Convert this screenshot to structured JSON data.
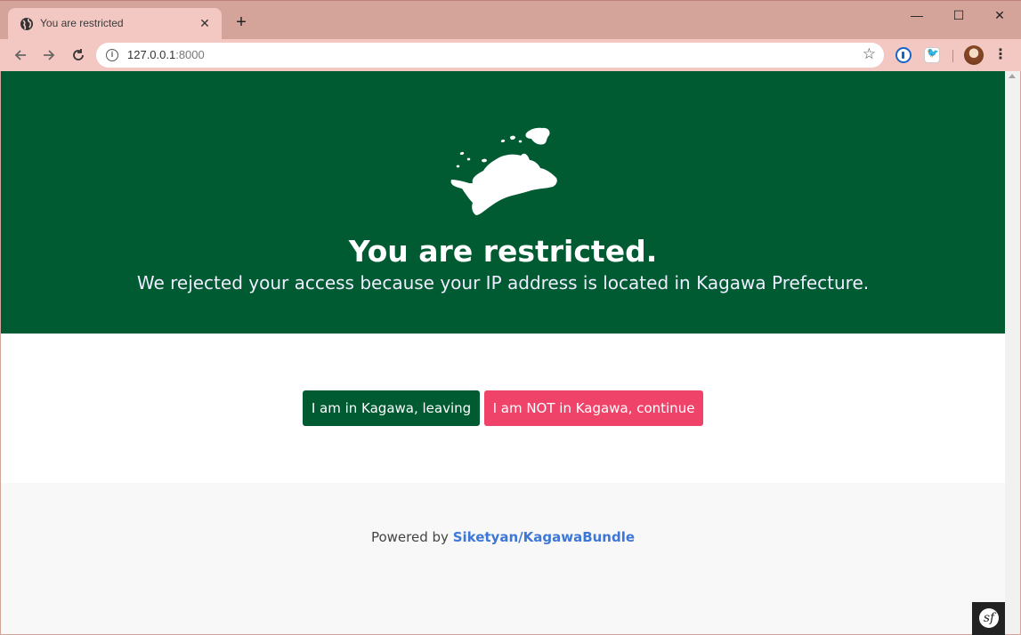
{
  "browser": {
    "tab_title": "You are restricted",
    "tab_close": "✕",
    "new_tab": "+",
    "window_controls": {
      "minimize": "—",
      "maximize": "☐",
      "close": "✕"
    },
    "url_host": "127.0.0.1",
    "url_port": ":8000",
    "icons": [
      "back-arrow-icon",
      "forward-arrow-icon",
      "reload-icon",
      "info-icon",
      "star-icon",
      "1password-extension-icon",
      "twitter-extension-icon",
      "profile-avatar",
      "kebab-menu-icon"
    ]
  },
  "page": {
    "hero": {
      "bg_color": "#005a32",
      "title": "You are restricted.",
      "subtitle": "We rejected your access because your IP address is located in Kagawa Prefecture."
    },
    "buttons": {
      "leave_label": "I am in Kagawa, leaving",
      "continue_label": "I am NOT in Kagawa, continue",
      "leave_color": "#005a32",
      "continue_color": "#f0436a"
    },
    "footer": {
      "powered_prefix": "Powered by",
      "link_text": "Siketyan/KagawaBundle"
    },
    "symfony_logo": "sf"
  }
}
